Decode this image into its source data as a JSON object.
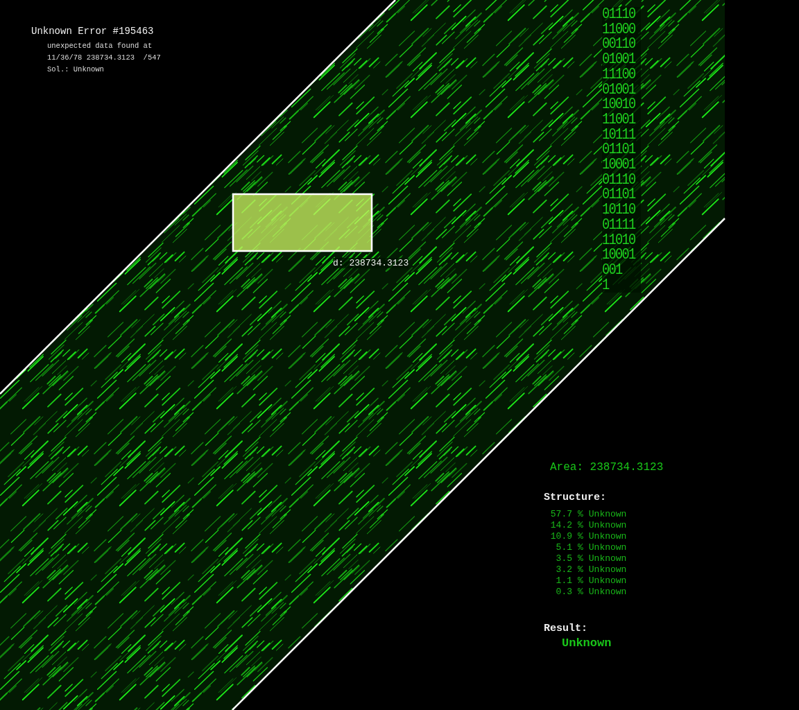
{
  "error": {
    "title": "Unknown Error #195463",
    "lines": [
      "unexpected data found at",
      "11/36/78 238734.3123  /547",
      "Sol.: Unknown"
    ]
  },
  "binary_stream": [
    "01110",
    "11000",
    "00110",
    "01001",
    "11100",
    "01001",
    "10010",
    "11001",
    "10111",
    "01101",
    "10001",
    "01110",
    "01101",
    "10110",
    "01111",
    "11010",
    "10001",
    "001",
    "1"
  ],
  "selection": {
    "label": "d: 238734.3123"
  },
  "area": "Area: 238734.3123",
  "structure": {
    "heading": "Structure:",
    "rows": [
      {
        "percent": "57.7",
        "unit": "%",
        "label": "Unknown"
      },
      {
        "percent": "14.2",
        "unit": "%",
        "label": "Unknown"
      },
      {
        "percent": "10.9",
        "unit": "%",
        "label": "Unknown"
      },
      {
        "percent": "5.1",
        "unit": "%",
        "label": "Unknown"
      },
      {
        "percent": "3.5",
        "unit": "%",
        "label": "Unknown"
      },
      {
        "percent": "3.2",
        "unit": "%",
        "label": "Unknown"
      },
      {
        "percent": "1.1",
        "unit": "%",
        "label": "Unknown"
      },
      {
        "percent": "0.3",
        "unit": "%",
        "label": "Unknown"
      }
    ]
  },
  "result": {
    "heading": "Result:",
    "value": "Unknown"
  }
}
